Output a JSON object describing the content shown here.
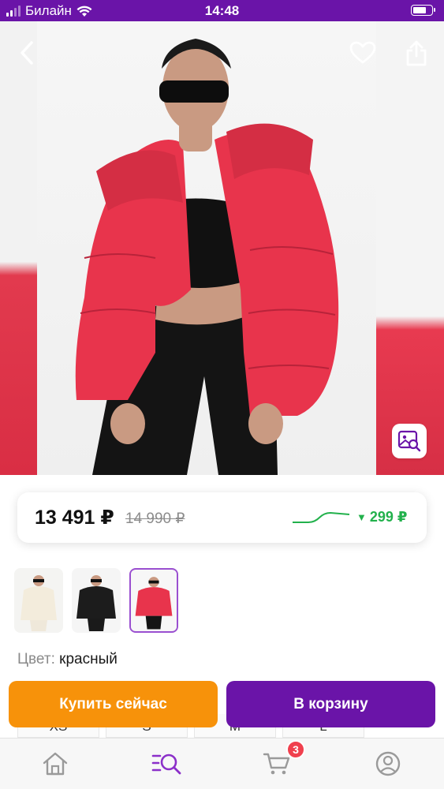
{
  "status_bar": {
    "carrier": "Билайн",
    "time": "14:48"
  },
  "gallery": {
    "back_icon": "chevron-left-icon",
    "favorite_icon": "heart-outline-icon",
    "share_icon": "share-icon",
    "photo_search_icon": "image-search-icon"
  },
  "price": {
    "current": "13 491 ₽",
    "old": "14 990 ₽",
    "drop": "299 ₽",
    "drop_icon": "triangle-down-icon",
    "trend_color": "#22b14c"
  },
  "thumbnails": [
    {
      "color": "white",
      "selected": false
    },
    {
      "color": "black",
      "selected": false
    },
    {
      "color": "red",
      "selected": true
    }
  ],
  "color": {
    "label": "Цвет:",
    "value": "красный"
  },
  "sizes": [
    "XS",
    "S",
    "M",
    "L"
  ],
  "actions": {
    "buy_now": "Купить сейчас",
    "add_to_cart": "В корзину"
  },
  "tab_bar": {
    "items": [
      {
        "icon": "home-icon"
      },
      {
        "icon": "catalog-search-icon"
      },
      {
        "icon": "cart-icon"
      },
      {
        "icon": "profile-icon"
      }
    ],
    "cart_count": "3"
  },
  "colors": {
    "brand_purple": "#6a14a8",
    "buy_orange": "#f7920a",
    "price_drop_green": "#22b14c",
    "badge_red": "#f0404e",
    "jacket_red": "#e8344c"
  }
}
